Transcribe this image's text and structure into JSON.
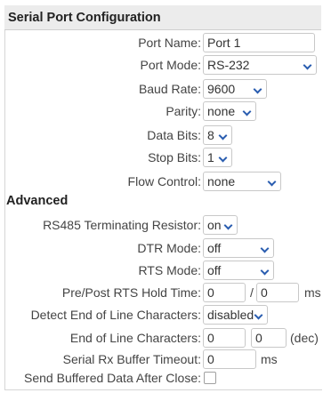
{
  "header": {
    "title": "Serial Port Configuration"
  },
  "section_advanced": "Advanced",
  "fields": {
    "port_name": {
      "label": "Port Name:",
      "value": "Port 1"
    },
    "port_mode": {
      "label": "Port Mode:",
      "value": "RS-232"
    },
    "baud_rate": {
      "label": "Baud Rate:",
      "value": "9600"
    },
    "parity": {
      "label": "Parity:",
      "value": "none"
    },
    "data_bits": {
      "label": "Data Bits:",
      "value": "8"
    },
    "stop_bits": {
      "label": "Stop Bits:",
      "value": "1"
    },
    "flow_control": {
      "label": "Flow Control:",
      "value": "none"
    },
    "rs485_resistor": {
      "label": "RS485 Terminating Resistor:",
      "value": "on"
    },
    "dtr_mode": {
      "label": "DTR Mode:",
      "value": "off"
    },
    "rts_mode": {
      "label": "RTS Mode:",
      "value": "off"
    },
    "rts_hold_time": {
      "label": "Pre/Post RTS Hold Time:",
      "pre": "0",
      "separator": "/",
      "post": "0",
      "unit": "ms"
    },
    "detect_eol": {
      "label": "Detect End of Line Characters:",
      "value": "disabled"
    },
    "eol_chars": {
      "label": "End of Line Characters:",
      "first": "0",
      "second": "0",
      "unit": "(dec)"
    },
    "rx_timeout": {
      "label": "Serial Rx Buffer Timeout:",
      "value": "0",
      "unit": "ms"
    },
    "send_after_close": {
      "label": "Send Buffered Data After Close:",
      "checked": false
    }
  },
  "colors": {
    "header_bg": "#ececec",
    "chevron": "#2a5db0",
    "border": "#c8c8c8"
  }
}
